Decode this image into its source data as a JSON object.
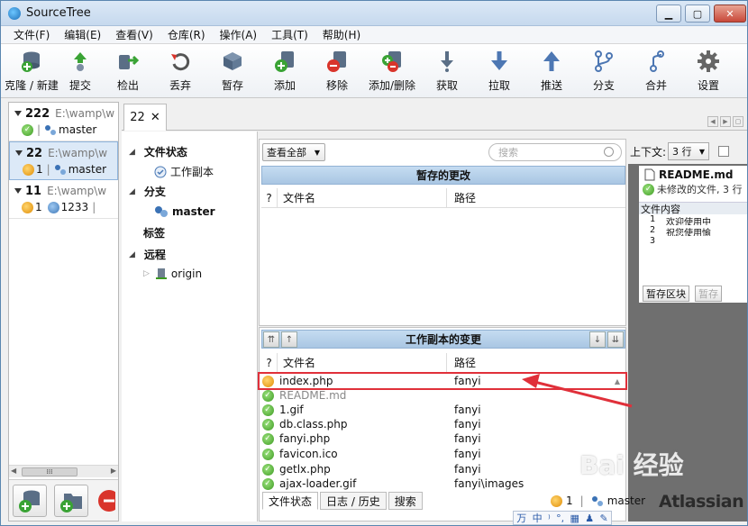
{
  "window": {
    "title": "SourceTree"
  },
  "menu": [
    "文件(F)",
    "编辑(E)",
    "查看(V)",
    "仓库(R)",
    "操作(A)",
    "工具(T)",
    "帮助(H)"
  ],
  "toolbar": [
    {
      "label": "克隆 / 新建",
      "icon": "clone-new-icon"
    },
    {
      "label": "提交",
      "icon": "commit-icon"
    },
    {
      "label": "检出",
      "icon": "checkout-icon"
    },
    {
      "label": "丢弃",
      "icon": "discard-icon"
    },
    {
      "label": "暂存",
      "icon": "stash-icon"
    },
    {
      "label": "添加",
      "icon": "add-icon"
    },
    {
      "label": "移除",
      "icon": "remove-icon"
    },
    {
      "label": "添加/删除",
      "icon": "add-remove-icon"
    },
    {
      "label": "获取",
      "icon": "fetch-icon"
    },
    {
      "label": "拉取",
      "icon": "pull-icon"
    },
    {
      "label": "推送",
      "icon": "push-icon"
    },
    {
      "label": "分支",
      "icon": "branch-icon"
    },
    {
      "label": "合并",
      "icon": "merge-icon"
    },
    {
      "label": "设置",
      "icon": "settings-icon"
    }
  ],
  "repos": [
    {
      "name": "222",
      "path": "E:\\wamp\\w",
      "branch": "master",
      "status": "clean"
    },
    {
      "name": "22",
      "path": "E:\\wamp\\w",
      "branch": "master",
      "modified": "1",
      "selected": true
    },
    {
      "name": "11",
      "path": "E:\\wamp\\w",
      "modified": "1",
      "ahead": "1233"
    }
  ],
  "tab": {
    "label": "22",
    "close": "✕"
  },
  "tree": {
    "file_status": "文件状态",
    "working_copy": "工作副本",
    "branches": "分支",
    "branch_master": "master",
    "tags": "标签",
    "remotes": "远程",
    "remote_origin": "origin"
  },
  "staged": {
    "filter": "查看全部",
    "search_placeholder": "搜索",
    "header": "暂存的更改",
    "col_q": "?",
    "col_file": "文件名",
    "col_path": "路径"
  },
  "working": {
    "header": "工作副本的变更",
    "col_q": "?",
    "col_file": "文件名",
    "col_path": "路径",
    "files": [
      {
        "name": "index.php",
        "path": "fanyi",
        "status": "modified",
        "highlight": true
      },
      {
        "name": "README.md",
        "path": "",
        "status": "clean",
        "faded": true
      },
      {
        "name": "1.gif",
        "path": "fanyi",
        "status": "clean"
      },
      {
        "name": "db.class.php",
        "path": "fanyi",
        "status": "clean"
      },
      {
        "name": "fanyi.php",
        "path": "fanyi",
        "status": "clean"
      },
      {
        "name": "favicon.ico",
        "path": "fanyi",
        "status": "clean"
      },
      {
        "name": "getlx.php",
        "path": "fanyi",
        "status": "clean"
      },
      {
        "name": "ajax-loader.gif",
        "path": "fanyi\\images",
        "status": "clean"
      }
    ]
  },
  "bottom_tabs": [
    "文件状态",
    "日志 / 历史",
    "搜索"
  ],
  "diff": {
    "context_label": "上下文:",
    "context_value": "3 行",
    "file": "README.md",
    "status": "未修改的文件, 3 行",
    "hunk": "文件内容",
    "lines": [
      {
        "n": "1",
        "t": "欢迎使用中"
      },
      {
        "n": "2",
        "t": "祝您使用愉"
      },
      {
        "n": "3",
        "t": ""
      }
    ],
    "btn_stage": "暂存区块",
    "btn_stage2": "暂存"
  },
  "status": {
    "modified": "1",
    "branch": "master"
  },
  "brand": "Atlassian",
  "watermark": "Bai 经验",
  "ime": [
    "万",
    "中",
    "⁾",
    "°,",
    "▦",
    "♟",
    "✎"
  ],
  "colors": {
    "accent": "#a9c6e3",
    "highlight": "#e0303a",
    "green": "#3c9a21",
    "orange": "#e08d07"
  }
}
